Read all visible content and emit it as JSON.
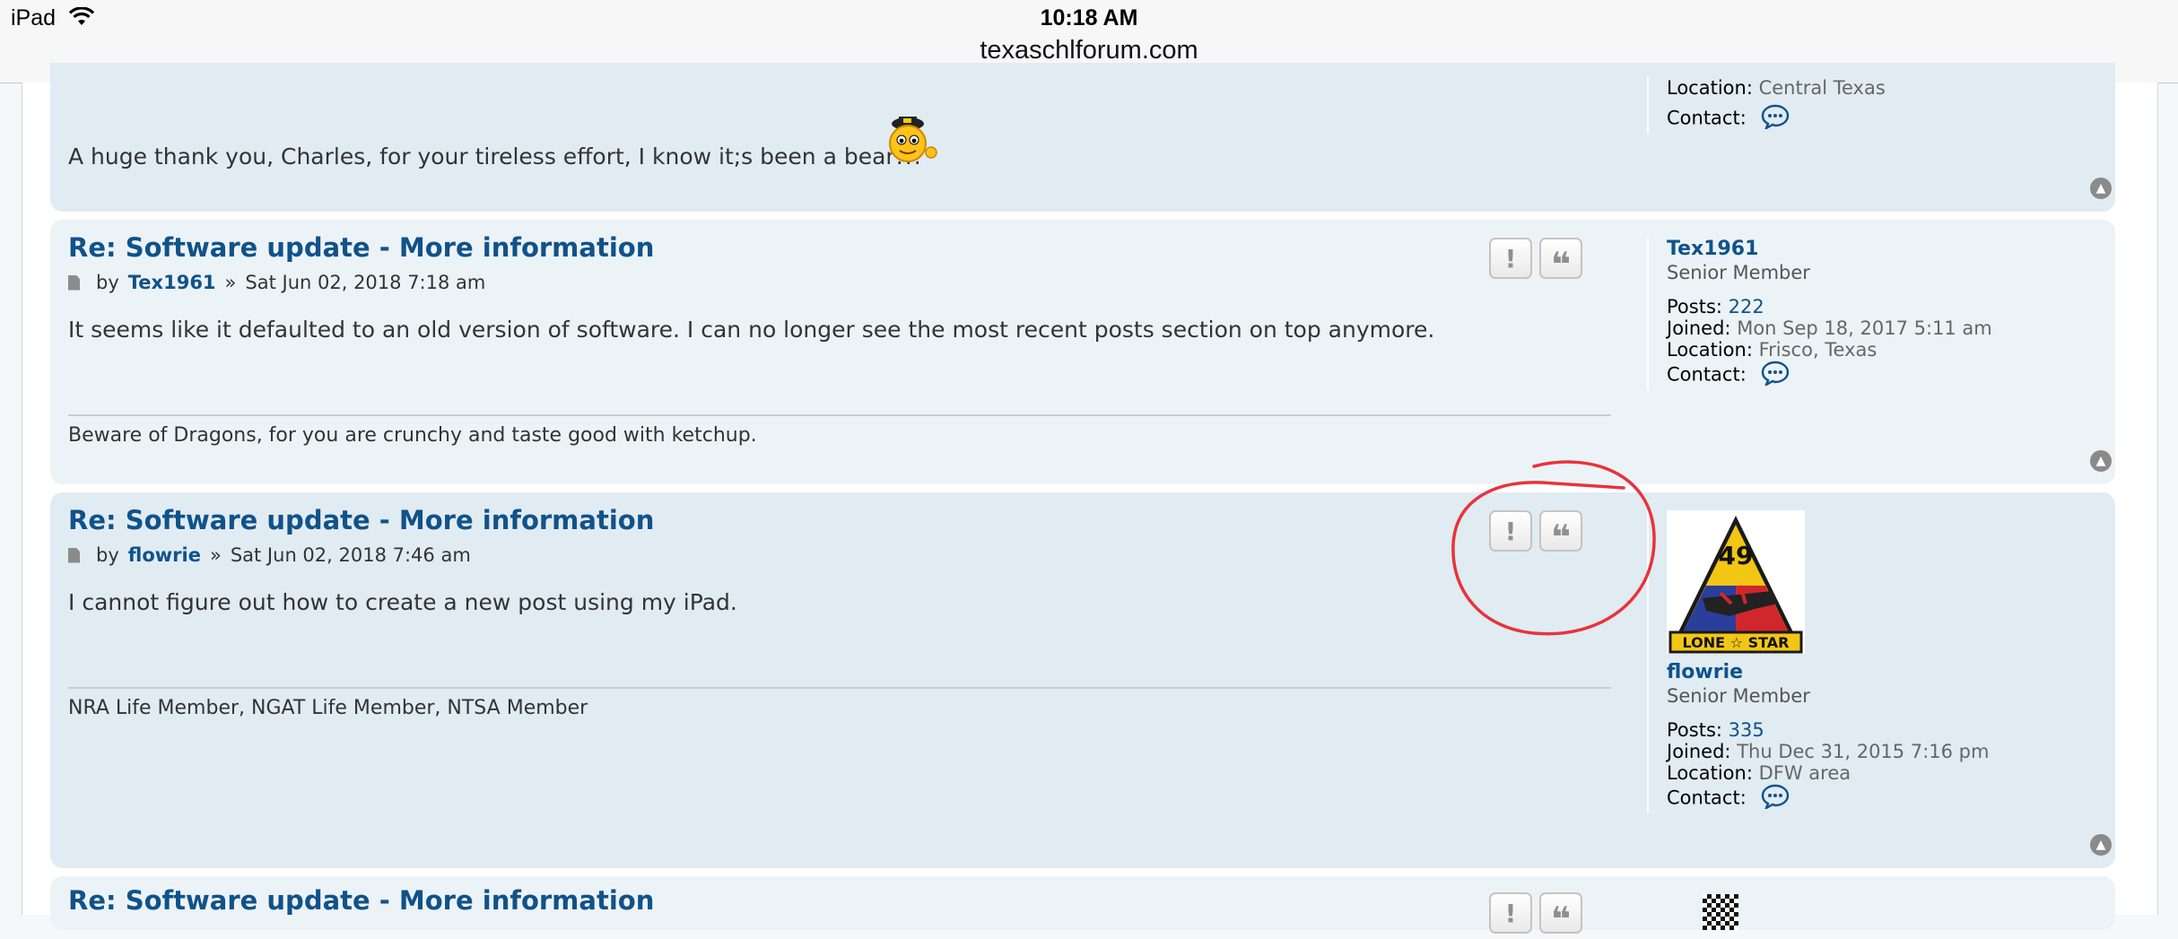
{
  "status_bar": {
    "device": "iPad",
    "time": "10:18 AM",
    "url": "texaschlforum.com"
  },
  "posts": [
    {
      "body": "A huge thank you, Charles, for your tireless effort, I know it;s been a bear!!!",
      "profile": {
        "location_label": "Location:",
        "location": "Central Texas",
        "contact_label": "Contact:"
      }
    },
    {
      "title": "Re: Software update - More information",
      "by": "by",
      "author": "Tex1961",
      "sep": "»",
      "date": "Sat Jun 02, 2018 7:18 am",
      "body": "It seems like it defaulted to an old version of software. I can no longer see the most recent posts section on top anymore.",
      "signature": "Beware of Dragons, for you are crunchy and taste good with ketchup.",
      "profile": {
        "username": "Tex1961",
        "rank": "Senior Member",
        "posts_label": "Posts:",
        "posts": "222",
        "joined_label": "Joined:",
        "joined": "Mon Sep 18, 2017 5:11 am",
        "location_label": "Location:",
        "location": "Frisco, Texas",
        "contact_label": "Contact:"
      }
    },
    {
      "title": "Re: Software update - More information",
      "by": "by",
      "author": "flowrie",
      "sep": "»",
      "date": "Sat Jun 02, 2018 7:46 am",
      "body": "I cannot figure out how to create a new post using my iPad.",
      "signature": "NRA Life Member, NGAT Life Member, NTSA Member",
      "profile": {
        "username": "flowrie",
        "rank": "Senior Member",
        "posts_label": "Posts:",
        "posts": "335",
        "joined_label": "Joined:",
        "joined": "Thu Dec 31, 2015 7:16 pm",
        "location_label": "Location:",
        "location": "DFW area",
        "contact_label": "Contact:",
        "avatar": {
          "number": "49",
          "text": "LONE ☆ STAR"
        }
      }
    },
    {
      "title": "Re: Software update - More information"
    }
  ],
  "buttons": {
    "report_glyph": "!",
    "quote_glyph": "❝"
  },
  "colors": {
    "link": "#105289",
    "post_bg_1": "#e1ebf2",
    "post_bg_2": "#ecf3f7",
    "annotation": "#e8333c"
  }
}
